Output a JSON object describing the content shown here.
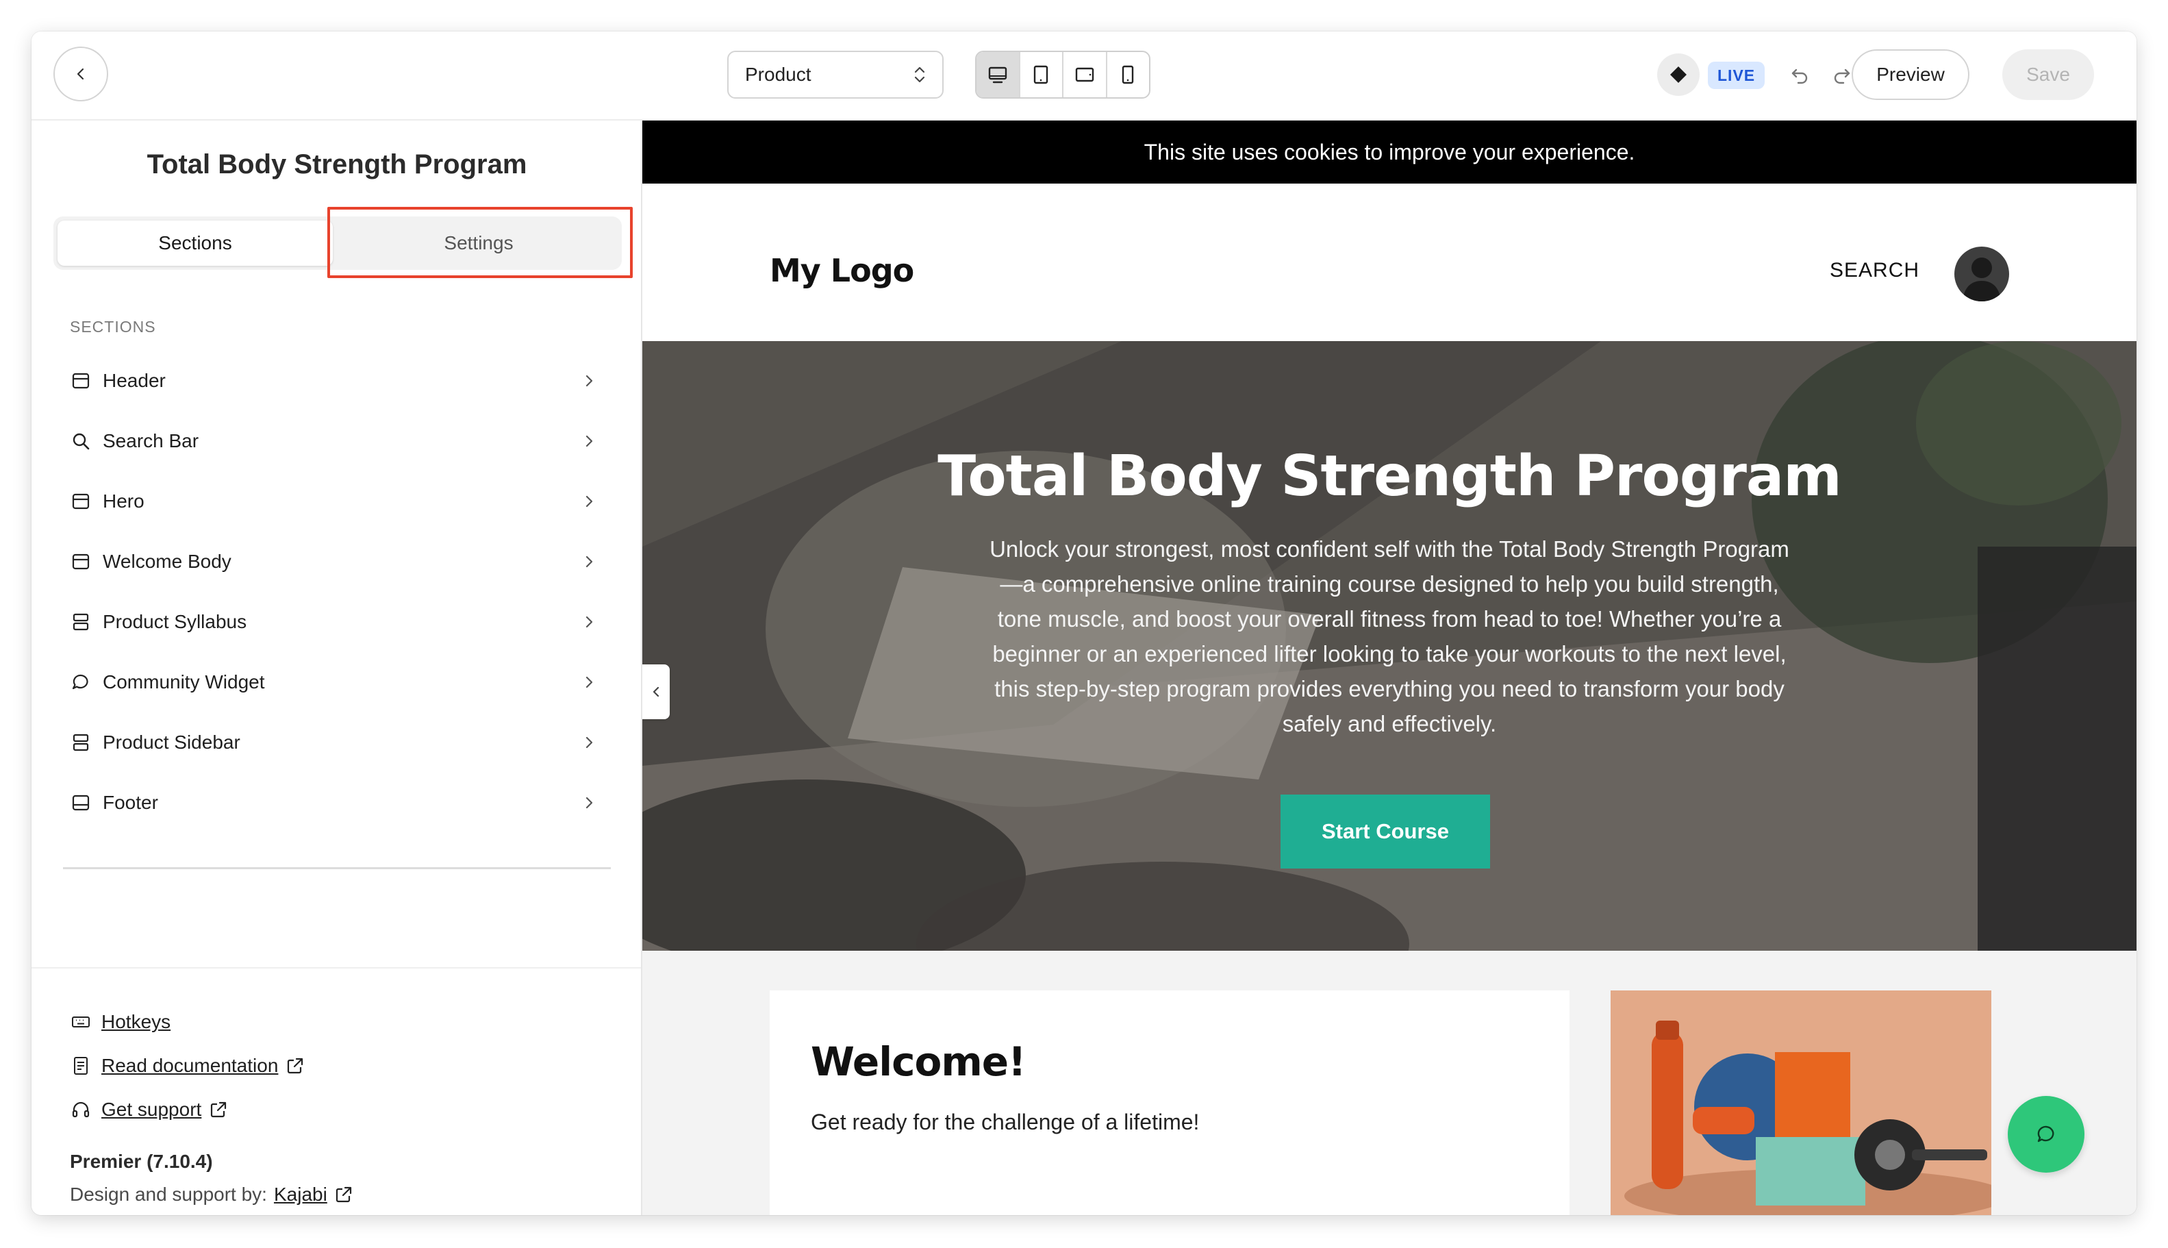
{
  "topbar": {
    "page_select_value": "Product",
    "live_badge": "LIVE",
    "preview_label": "Preview",
    "save_label": "Save"
  },
  "sidebar": {
    "title": "Total Body Strength Program",
    "tabs": {
      "sections": "Sections",
      "settings": "Settings"
    },
    "sections_heading": "SECTIONS",
    "items": [
      {
        "label": "Header",
        "icon": "layout-icon"
      },
      {
        "label": "Search Bar",
        "icon": "search-icon"
      },
      {
        "label": "Hero",
        "icon": "layout-icon"
      },
      {
        "label": "Welcome Body",
        "icon": "layout-icon"
      },
      {
        "label": "Product Syllabus",
        "icon": "rows-icon"
      },
      {
        "label": "Community Widget",
        "icon": "chat-bubble-icon"
      },
      {
        "label": "Product Sidebar",
        "icon": "rows-icon"
      },
      {
        "label": "Footer",
        "icon": "footer-icon"
      }
    ],
    "footer": {
      "hotkeys": "Hotkeys",
      "documentation": "Read documentation",
      "support": "Get support",
      "version": "Premier (7.10.4)",
      "credit_prefix": "Design and support by:",
      "credit_link": "Kajabi"
    }
  },
  "preview": {
    "cookie_text": "This site uses cookies to improve your experience.",
    "logo": "My Logo",
    "search_label": "SEARCH",
    "hero": {
      "title": "Total Body Strength Program",
      "text": "Unlock your strongest, most confident self with the Total Body Strength Program—a comprehensive online training course designed to help you build strength, tone muscle, and boost your overall fitness from head to toe! Whether you’re a beginner or an experienced lifter looking to take your workouts to the next level, this step-by-step program provides everything you need to transform your body safely and effectively.",
      "button": "Start Course"
    },
    "welcome": {
      "title": "Welcome!",
      "text": "Get ready for the challenge of a lifetime!"
    }
  },
  "colors": {
    "accent_button": "#1fae93",
    "chat_button": "#2ec77a",
    "highlight": "#e8432d",
    "live_badge_bg": "#d9e8ff",
    "live_badge_text": "#1e56d6"
  }
}
